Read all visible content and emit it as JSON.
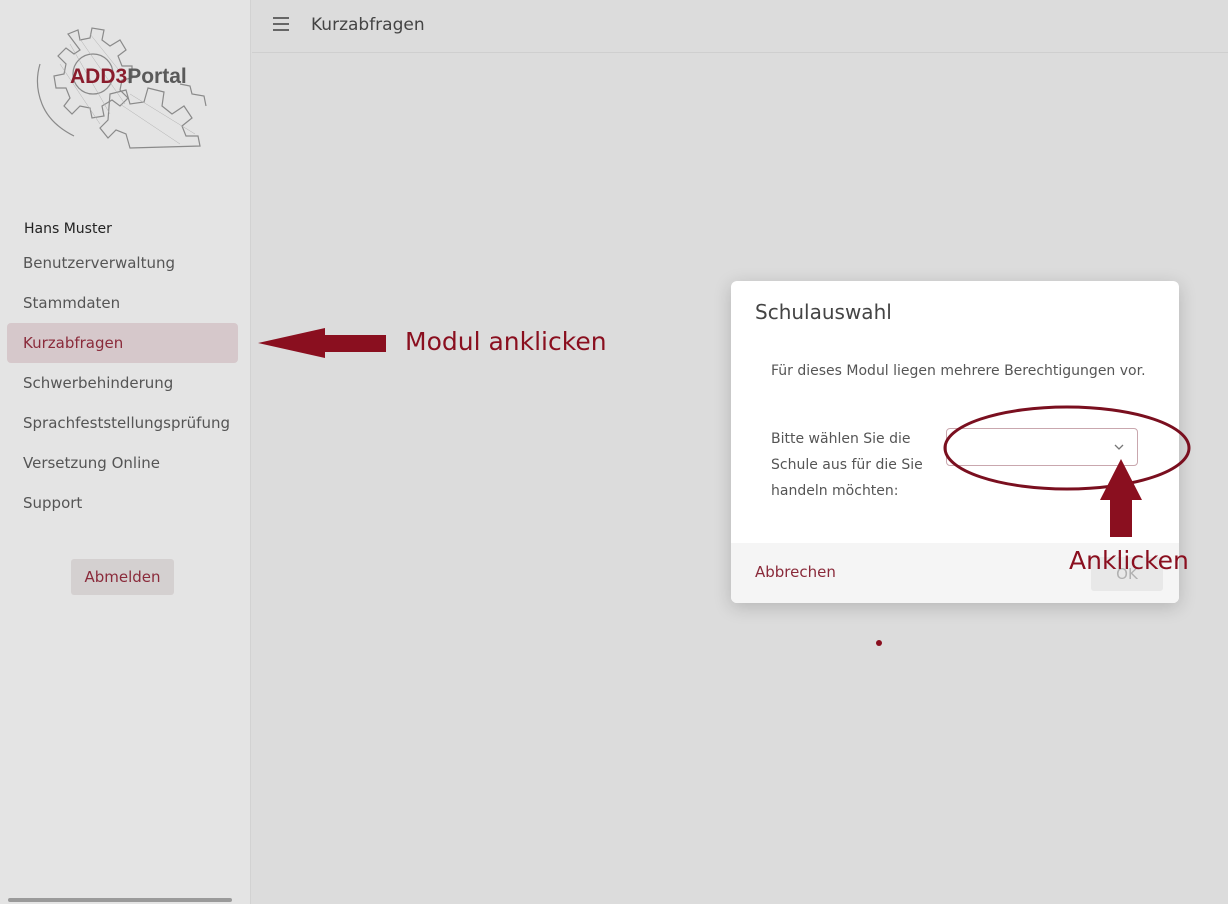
{
  "sidebar": {
    "logo": {
      "part1": "ADD3",
      "part2": "Portal"
    },
    "user_name": "Hans Muster",
    "items": [
      {
        "label": "Benutzerverwaltung",
        "active": false
      },
      {
        "label": "Stammdaten",
        "active": false
      },
      {
        "label": "Kurzabfragen",
        "active": true
      },
      {
        "label": "Schwerbehinderung",
        "active": false
      },
      {
        "label": "Sprachfeststellungsprüfung",
        "active": false
      },
      {
        "label": "Versetzung Online",
        "active": false
      },
      {
        "label": "Support",
        "active": false
      }
    ],
    "logout_label": "Abmelden"
  },
  "header": {
    "icon": "menu-icon",
    "title": "Kurzabfragen"
  },
  "dialog": {
    "title": "Schulauswahl",
    "text": "Für dieses Modul liegen mehrere Berechtigungen vor.",
    "select_label": "Bitte wählen Sie die Schule aus für die Sie handeln möchten:",
    "select_value": "",
    "cancel_label": "Abbrechen",
    "ok_label": "OK"
  },
  "annotations": {
    "module_hint": "Modul anklicken",
    "select_hint": "Anklicken",
    "color": "#8a0f1f"
  },
  "colors": {
    "accent": "#8a2a3a",
    "background": "#dcdcdc",
    "sidebar": "#e4e4e4"
  }
}
